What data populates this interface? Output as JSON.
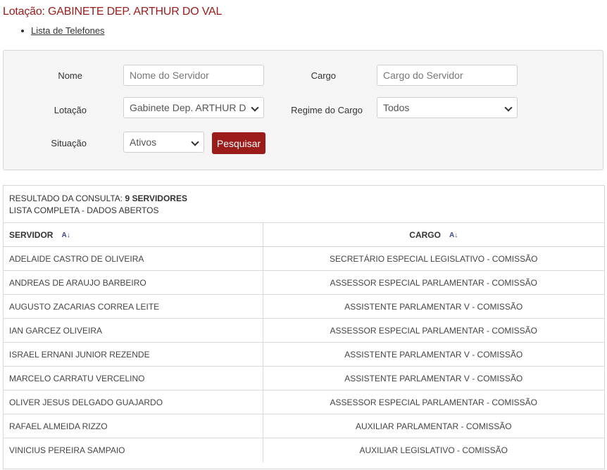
{
  "header": {
    "title": "Lotação: GABINETE DEP. ARTHUR DO VAL",
    "links": [
      {
        "label": "Lista de Telefones"
      }
    ]
  },
  "filters": {
    "nome": {
      "label": "Nome",
      "placeholder": "Nome do Servidor"
    },
    "cargo": {
      "label": "Cargo",
      "placeholder": "Cargo do Servidor"
    },
    "lotacao": {
      "label": "Lotação",
      "value": "Gabinete Dep. ARTHUR DO VAL"
    },
    "regime": {
      "label": "Regime do Cargo",
      "value": "Todos"
    },
    "situacao": {
      "label": "Situação",
      "value": "Ativos"
    },
    "search_label": "Pesquisar"
  },
  "results": {
    "summary_prefix": "RESULTADO DA CONSULTA:",
    "summary_count": "9 SERVIDORES",
    "summary_sub": "LISTA COMPLETA - DADOS ABERTOS",
    "columns": [
      "SERVIDOR",
      "CARGO"
    ],
    "sort_icon": "sort-alpha-icon",
    "rows": [
      {
        "servidor": "ADELAIDE CASTRO DE OLIVEIRA",
        "cargo": "SECRETÁRIO ESPECIAL LEGISLATIVO - COMISSÃO"
      },
      {
        "servidor": "ANDREAS DE ARAUJO BARBEIRO",
        "cargo": "ASSESSOR ESPECIAL PARLAMENTAR - COMISSÃO"
      },
      {
        "servidor": "AUGUSTO ZACARIAS CORREA LEITE",
        "cargo": "ASSISTENTE PARLAMENTAR V - COMISSÃO"
      },
      {
        "servidor": "IAN GARCEZ OLIVEIRA",
        "cargo": "ASSESSOR ESPECIAL PARLAMENTAR - COMISSÃO"
      },
      {
        "servidor": "ISRAEL ERNANI JUNIOR REZENDE",
        "cargo": "ASSISTENTE PARLAMENTAR V - COMISSÃO"
      },
      {
        "servidor": "MARCELO CARRATU VERCELINO",
        "cargo": "ASSISTENTE PARLAMENTAR V - COMISSÃO"
      },
      {
        "servidor": "OLIVER JESUS DELGADO GUAJARDO",
        "cargo": "ASSESSOR ESPECIAL PARLAMENTAR - COMISSÃO"
      },
      {
        "servidor": "RAFAEL ALMEIDA RIZZO",
        "cargo": "AUXILIAR PARLAMENTAR - COMISSÃO"
      },
      {
        "servidor": "VINICIUS PEREIRA SAMPAIO",
        "cargo": "AUXILIAR LEGISLATIVO - COMISSÃO"
      }
    ]
  },
  "colors": {
    "accent": "#9b1b1b",
    "panel_bg": "#f5f5f5"
  }
}
